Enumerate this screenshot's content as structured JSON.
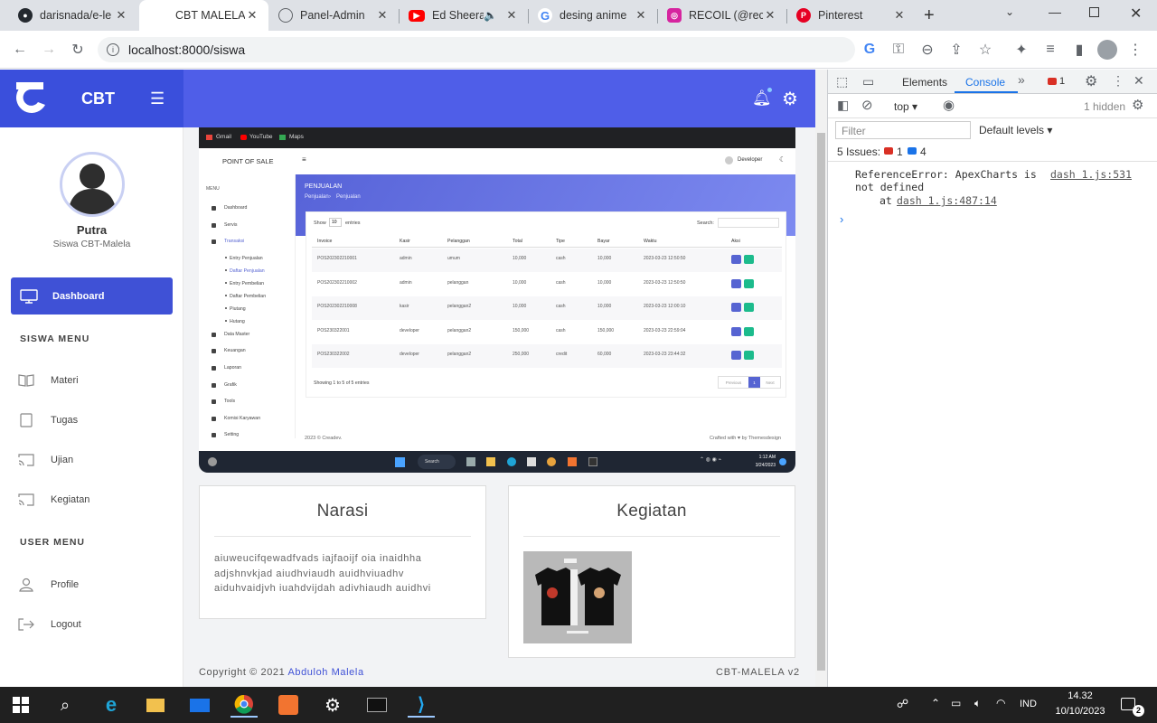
{
  "browser": {
    "tabs": [
      {
        "title": "darisnada/e-le",
        "icon": "github-icon",
        "color": "#24292f"
      },
      {
        "title": "CBT MALELA |",
        "icon": "none",
        "color": "#ffffff",
        "active": true
      },
      {
        "title": "Panel-Admin",
        "icon": "globe-icon",
        "color": "#5f6368"
      },
      {
        "title": "Ed Sheera",
        "icon": "youtube-icon",
        "color": "#ff0000"
      },
      {
        "title": "desing anime",
        "icon": "google-icon",
        "color": "#4285f4"
      },
      {
        "title": "RECOIL (@rec",
        "icon": "instagram-icon",
        "color": "#d6249f"
      },
      {
        "title": "Pinterest",
        "icon": "pinterest-icon",
        "color": "#e60023"
      }
    ],
    "url": "localhost:8000/siswa"
  },
  "app": {
    "brand": "CBT",
    "user_name": "Putra",
    "user_role": "Siswa CBT-Malela",
    "dashboard_label": "Dashboard",
    "siswa_menu_heading": "SISWA MENU",
    "siswa_menu": [
      "Materi",
      "Tugas",
      "Ujian",
      "Kegiatan"
    ],
    "user_menu_heading": "USER MENU",
    "user_menu": [
      "Profile",
      "Logout"
    ],
    "narasi_title": "Narasi",
    "narasi_text": "aiuweucifqewadfvads iajfaoijf oia inaidhha adjshnvkjad aiudhviaudh auidhviuadhv aiduhvaidjvh iuahdvijdah adivhiaudh auidhvi",
    "kegiatan_title": "Kegiatan",
    "footer_left": "Copyright © 2021",
    "footer_author": "Abduloh Malela",
    "footer_right": "CBT-MALELA v2"
  },
  "embedded": {
    "bookmarks": [
      "Gmail",
      "YouTube",
      "Maps"
    ],
    "pos_title": "POINT OF SALE",
    "user": "Developer",
    "page_title": "PENJUALAN",
    "breadcrumb": [
      "Penjualan",
      "Penjualan"
    ],
    "menu_label": "MENU",
    "menu": [
      "Dashboard",
      "Servis",
      "Transaksi",
      "Entry Penjualan",
      "Daftar Penjualan",
      "Entry Pembelian",
      "Daftar Pembelian",
      "Piutang",
      "Hutang",
      "Data Master",
      "Keuangan",
      "Laporan",
      "Grafik",
      "Tools",
      "Komisi Karyawan",
      "Setting"
    ],
    "show_label": "Show",
    "show_value": "10",
    "entries_label": "entries",
    "search_label": "Search:",
    "columns": [
      "Invoice",
      "Kasir",
      "Pelanggan",
      "Total",
      "Tipe",
      "Bayar",
      "Waktu",
      "Aksi"
    ],
    "rows": [
      [
        "POS202302210001",
        "admin",
        "umum",
        "10,000",
        "cash",
        "10,000",
        "2023-03-23 12:50:50"
      ],
      [
        "POS202302210002",
        "admin",
        "pelanggan",
        "10,000",
        "cash",
        "10,000",
        "2023-03-23 12:50:50"
      ],
      [
        "POS202302210008",
        "kasir",
        "pelanggan2",
        "10,000",
        "cash",
        "10,000",
        "2023-03-23 12:00:10"
      ],
      [
        "POS230322001",
        "developer",
        "pelanggan2",
        "150,000",
        "cash",
        "150,000",
        "2023-03-23 22:59:04"
      ],
      [
        "POS230322002",
        "developer",
        "pelanggan2",
        "250,000",
        "credit",
        "60,000",
        "2023-03-23 23:44:32"
      ]
    ],
    "showing": "Showing 1 to 5 of 5 entries",
    "pager": [
      "Previous",
      "1",
      "Next"
    ],
    "footer_left": "2023 © Creadev.",
    "footer_right": "Crafted with ♥ by Themesdesign",
    "taskbar_search": "Search",
    "taskbar_time": "1:12 AM",
    "taskbar_date": "3/24/2023"
  },
  "devtools": {
    "tabs": [
      "Elements",
      "Console"
    ],
    "error_count": "1",
    "context": "top",
    "hidden": "1 hidden",
    "filter_placeholder": "Filter",
    "levels": "Default levels",
    "issues_label": "5 Issues:",
    "issues_errors": "1",
    "issues_info": "4",
    "error_line1": "ReferenceError: ApexCharts is",
    "error_line2": "not defined",
    "error_line3": "at",
    "error_src": "dash 1.js:531",
    "error_src2": "dash 1.js:487:14"
  },
  "taskbar": {
    "lang": "IND",
    "time": "14.32",
    "date": "10/10/2023",
    "notif_count": "2"
  }
}
